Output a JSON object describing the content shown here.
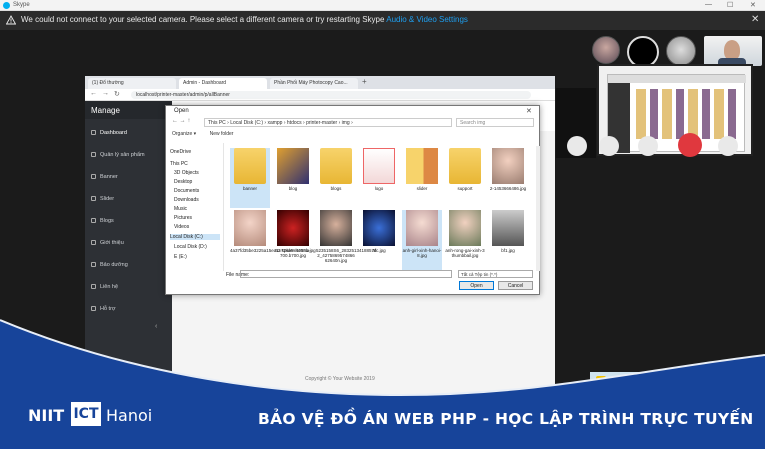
{
  "skype": {
    "title": "Skype",
    "window_controls": [
      "—",
      "☐",
      "✕"
    ]
  },
  "warning": {
    "message": "We could not connect to your selected camera. Please select a different camera or try restarting Skype",
    "link": "Audio & Video Settings",
    "close": "✕"
  },
  "browser": {
    "tabs": [
      {
        "label": "(1) Đổ thường"
      },
      {
        "label": "Admin - Dashboard"
      },
      {
        "label": "Phần Phối Máy Photocopy Cao..."
      }
    ],
    "new_tab": "+",
    "url": "localhost/printer-master/admin/p/allBanner"
  },
  "admin": {
    "brand": "Manage",
    "menu": [
      {
        "label": "Dashboard"
      },
      {
        "label": "Quản lý sản phẩm"
      },
      {
        "label": "Banner"
      },
      {
        "label": "Slider"
      },
      {
        "label": "Blogs"
      },
      {
        "label": "Giới thiệu"
      },
      {
        "label": "Bảo dưỡng"
      },
      {
        "label": "Liên hệ"
      },
      {
        "label": "Hỗ trợ"
      }
    ],
    "footer": "Copyright © Your Website 2019"
  },
  "dialog": {
    "title": "Open",
    "path": "This PC  ›  Local Disk (C:)  ›  xampp  ›  htdocs  ›  printer-master  ›  img  ›",
    "search_placeholder": "Search img",
    "organize": "Organize ▾",
    "new_folder": "New folder",
    "tree": [
      "OneDrive",
      "This PC",
      "3D Objects",
      "Desktop",
      "Documents",
      "Downloads",
      "Music",
      "Pictures",
      "Videos",
      "Local Disk (C:)",
      "Local Disk (D:)",
      "E (E:)"
    ],
    "files_row1": [
      "banner",
      "blog",
      "blogs",
      "logo",
      "slider",
      "support",
      "2-1453666486.jpg"
    ],
    "files_row2": [
      "4a37fd35be3225a15ea1c726e5c4258b.jpg",
      "52-spider-hermia-700.b700.jpg",
      "5235158S6_28325134188576 2_4275869574866 62640n.jpg",
      "afc.jpg",
      "anh-girl-xinh-hanoi-8.jpg",
      "anh-rong-gai-xinh-3 thumbbail.jpg",
      "bf1.jpg"
    ],
    "file_name_label": "File name:",
    "file_type": "Tất cả Tệp tin (*.*)",
    "open_label": "Open",
    "cancel_label": "Cancel"
  },
  "banner": {
    "brand_left": "NIIT",
    "brand_middle": "ICT",
    "brand_right": "Hanoi",
    "slogan": "BẢO VỆ ĐỒ ÁN WEB PHP - HỌC LẬP TRÌNH TRỰC TUYẾN"
  },
  "colors": {
    "skype_blue": "#00aff0",
    "banner_blue": "#17449a",
    "end_call": "#e0383e",
    "link": "#1e9ff0"
  }
}
